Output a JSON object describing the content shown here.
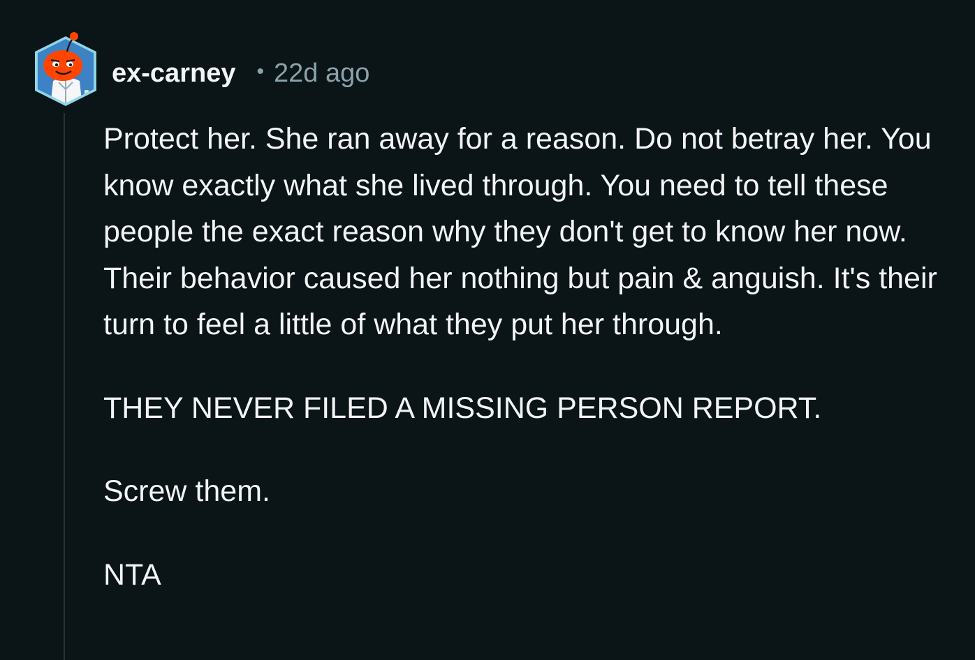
{
  "comment": {
    "author": "ex-carney",
    "separator": "•",
    "time_ago": "22d ago",
    "avatar_icon": "reddit-snoo-avatar-icon",
    "paragraphs": [
      "Protect her. She ran away for a reason. Do not betray her. You know exactly what she lived through. You need to tell these people the exact reason why they don't get to know her now. Their behavior caused her nothing but pain & anguish. It's their turn to feel a little of what they put her through.",
      "THEY NEVER FILED A MISSING PERSON REPORT.",
      "Screw them.",
      "NTA"
    ]
  },
  "colors": {
    "background": "#0b1416",
    "text": "#f2f4f5",
    "meta": "#8ba2ad",
    "thread_line": "#2a3236",
    "avatar_ring": "#8fd6e6",
    "avatar_orange": "#ff4500"
  }
}
